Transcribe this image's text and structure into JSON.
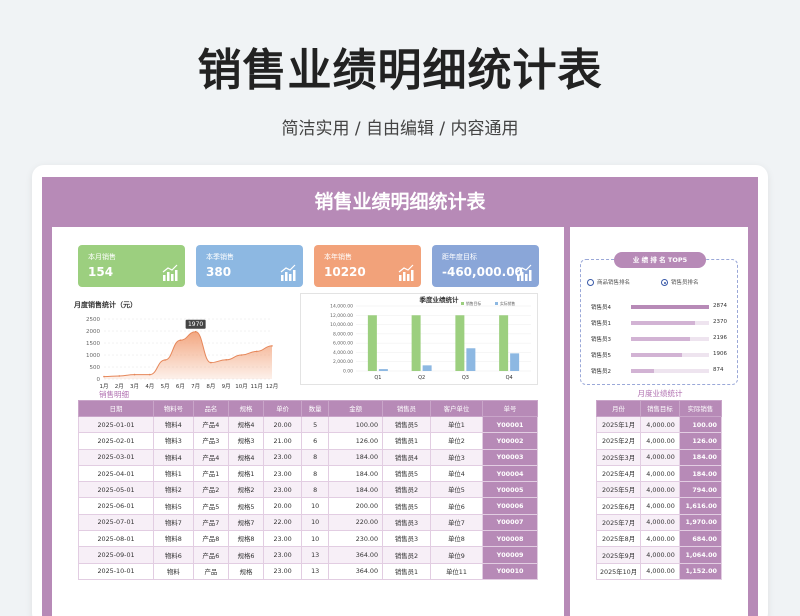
{
  "hero": {
    "title": "销售业绩明细统计表",
    "subtitle": "简洁实用 / 自由编辑 / 内容通用"
  },
  "sheet_title": "销售业绩明细统计表",
  "stats": [
    {
      "label": "本月销售",
      "value": "154",
      "color": "#9ccf7f"
    },
    {
      "label": "本季销售",
      "value": "380",
      "color": "#8db8e2"
    },
    {
      "label": "本年销售",
      "value": "10220",
      "color": "#f2a27a"
    },
    {
      "label": "距年度目标",
      "value": "-460,000.00",
      "color": "#8aa6d8"
    }
  ],
  "monthly_chart": {
    "title": "月度销售统计（元）",
    "peak_label": "1970"
  },
  "quarter_chart": {
    "title": "季度业绩统计",
    "legend": [
      "销售目标",
      "实际销售"
    ]
  },
  "chart_data": [
    {
      "type": "area",
      "title": "月度销售统计（元）",
      "categories": [
        "1月",
        "2月",
        "3月",
        "4月",
        "5月",
        "6月",
        "7月",
        "8月",
        "9月",
        "10月",
        "11月",
        "12月"
      ],
      "values": [
        100,
        126,
        184,
        184,
        794,
        1616,
        1970,
        684,
        800,
        1000,
        1150,
        1380
      ],
      "ylim": [
        0,
        2500
      ],
      "yticks": [
        "2500",
        "2000",
        "1500",
        "1000",
        "500",
        "0"
      ],
      "annotations": [
        "1970"
      ],
      "color": "#f2a27a"
    },
    {
      "type": "bar",
      "title": "季度业绩统计",
      "categories": [
        "Q1",
        "Q2",
        "Q3",
        "Q4"
      ],
      "series": [
        {
          "name": "销售目标",
          "values": [
            12000,
            12000,
            12000,
            12000
          ],
          "color": "#9ccf7f"
        },
        {
          "name": "实际销售",
          "values": [
            410,
            1216,
            4900,
            3800
          ],
          "color": "#8db8e2"
        }
      ],
      "ylim": [
        0,
        14000
      ],
      "yticks": [
        "14,000.00",
        "12,000.00",
        "10,000.00",
        "8,000.00",
        "6,000.00",
        "4,000.00",
        "2,000.00",
        "0.00"
      ]
    }
  ],
  "detail": {
    "section_label": "销售明细",
    "headers": [
      "日期",
      "物料号",
      "品名",
      "规格",
      "单价",
      "数量",
      "金额",
      "销售员",
      "客户单位",
      "单号"
    ],
    "rows": [
      [
        "2025-01-01",
        "物料4",
        "产品4",
        "规格4",
        "20.00",
        "5",
        "100.00",
        "销售员5",
        "单位1",
        "Y00001"
      ],
      [
        "2025-02-01",
        "物料3",
        "产品3",
        "规格3",
        "21.00",
        "6",
        "126.00",
        "销售员1",
        "单位2",
        "Y00002"
      ],
      [
        "2025-03-01",
        "物料4",
        "产品4",
        "规格4",
        "23.00",
        "8",
        "184.00",
        "销售员4",
        "单位3",
        "Y00003"
      ],
      [
        "2025-04-01",
        "物料1",
        "产品1",
        "规格1",
        "23.00",
        "8",
        "184.00",
        "销售员5",
        "单位4",
        "Y00004"
      ],
      [
        "2025-05-01",
        "物料2",
        "产品2",
        "规格2",
        "23.00",
        "8",
        "184.00",
        "销售员2",
        "单位5",
        "Y00005"
      ],
      [
        "2025-06-01",
        "物料5",
        "产品5",
        "规格5",
        "20.00",
        "10",
        "200.00",
        "销售员5",
        "单位6",
        "Y00006"
      ],
      [
        "2025-07-01",
        "物料7",
        "产品7",
        "规格7",
        "22.00",
        "10",
        "220.00",
        "销售员3",
        "单位7",
        "Y00007"
      ],
      [
        "2025-08-01",
        "物料8",
        "产品8",
        "规格8",
        "23.00",
        "10",
        "230.00",
        "销售员3",
        "单位8",
        "Y00008"
      ],
      [
        "2025-09-01",
        "物料6",
        "产品6",
        "规格6",
        "23.00",
        "13",
        "364.00",
        "销售员2",
        "单位9",
        "Y00009"
      ],
      [
        "2025-10-01",
        "物料",
        "产品",
        "规格",
        "23.00",
        "13",
        "364.00",
        "销售员1",
        "单位11",
        "Y00010"
      ]
    ]
  },
  "ranking": {
    "title": "业 绩 排 名 TOP5",
    "options": [
      "商品销售排名",
      "销售员排名"
    ],
    "items": [
      {
        "name": "销售员4",
        "value": "2874",
        "fraction": 1.0
      },
      {
        "name": "销售员1",
        "value": "2370",
        "fraction": 0.82
      },
      {
        "name": "销售员3",
        "value": "2196",
        "fraction": 0.76
      },
      {
        "name": "销售员5",
        "value": "1906",
        "fraction": 0.66
      },
      {
        "name": "销售员2",
        "value": "874",
        "fraction": 0.3
      }
    ]
  },
  "monthly_table": {
    "section_label": "月度业绩统计",
    "headers": [
      "月份",
      "销售目标",
      "实际销售"
    ],
    "rows": [
      [
        "2025年1月",
        "4,000.00",
        "100.00"
      ],
      [
        "2025年2月",
        "4,000.00",
        "126.00"
      ],
      [
        "2025年3月",
        "4,000.00",
        "184.00"
      ],
      [
        "2025年4月",
        "4,000.00",
        "184.00"
      ],
      [
        "2025年5月",
        "4,000.00",
        "794.00"
      ],
      [
        "2025年6月",
        "4,000.00",
        "1,616.00"
      ],
      [
        "2025年7月",
        "4,000.00",
        "1,970.00"
      ],
      [
        "2025年8月",
        "4,000.00",
        "684.00"
      ],
      [
        "2025年9月",
        "4,000.00",
        "1,064.00"
      ],
      [
        "2025年10月",
        "4,000.00",
        "1,152.00"
      ]
    ]
  }
}
